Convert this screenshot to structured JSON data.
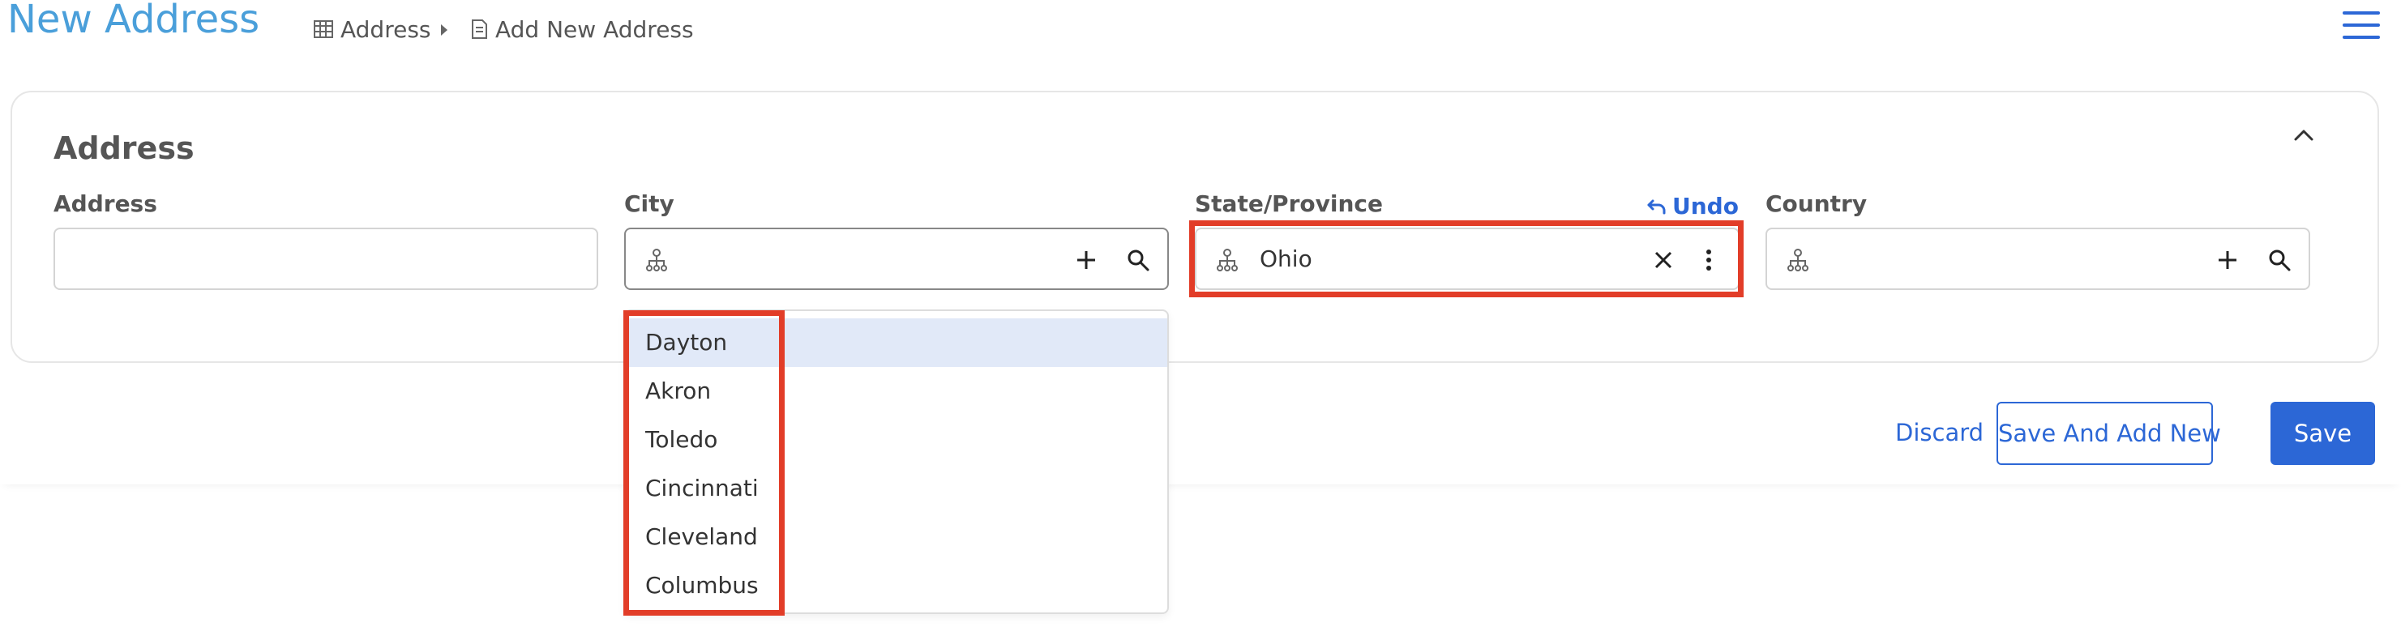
{
  "header": {
    "title": "New Address",
    "breadcrumb": [
      {
        "label": "Address",
        "icon": "table-icon"
      },
      {
        "label": "Add New Address",
        "icon": "document-icon"
      }
    ],
    "menu_icon": "hamburger-menu-icon"
  },
  "section": {
    "title": "Address",
    "collapse_icon": "chevron-up-icon"
  },
  "fields": {
    "address": {
      "label": "Address",
      "value": ""
    },
    "city": {
      "label": "City",
      "value": "",
      "icons": [
        "hierarchy-icon",
        "plus-icon",
        "search-icon"
      ]
    },
    "state": {
      "label": "State/Province",
      "value": "Ohio",
      "undo_label": "Undo",
      "icons": [
        "hierarchy-icon",
        "clear-icon",
        "more-vertical-icon"
      ]
    },
    "country": {
      "label": "Country",
      "value": "",
      "icons": [
        "hierarchy-icon",
        "plus-icon",
        "search-icon"
      ]
    }
  },
  "city_dropdown": {
    "options": [
      "Dayton",
      "Akron",
      "Toledo",
      "Cincinnati",
      "Cleveland",
      "Columbus"
    ],
    "highlighted": "Dayton"
  },
  "actions": {
    "discard": "Discard",
    "save_and_add_new": "Save And Add New",
    "save": "Save"
  },
  "colors": {
    "accent": "#2c67d6",
    "title": "#4a9fda",
    "highlight_box": "#e23d28",
    "selected_option_bg": "#e1e9f8"
  }
}
